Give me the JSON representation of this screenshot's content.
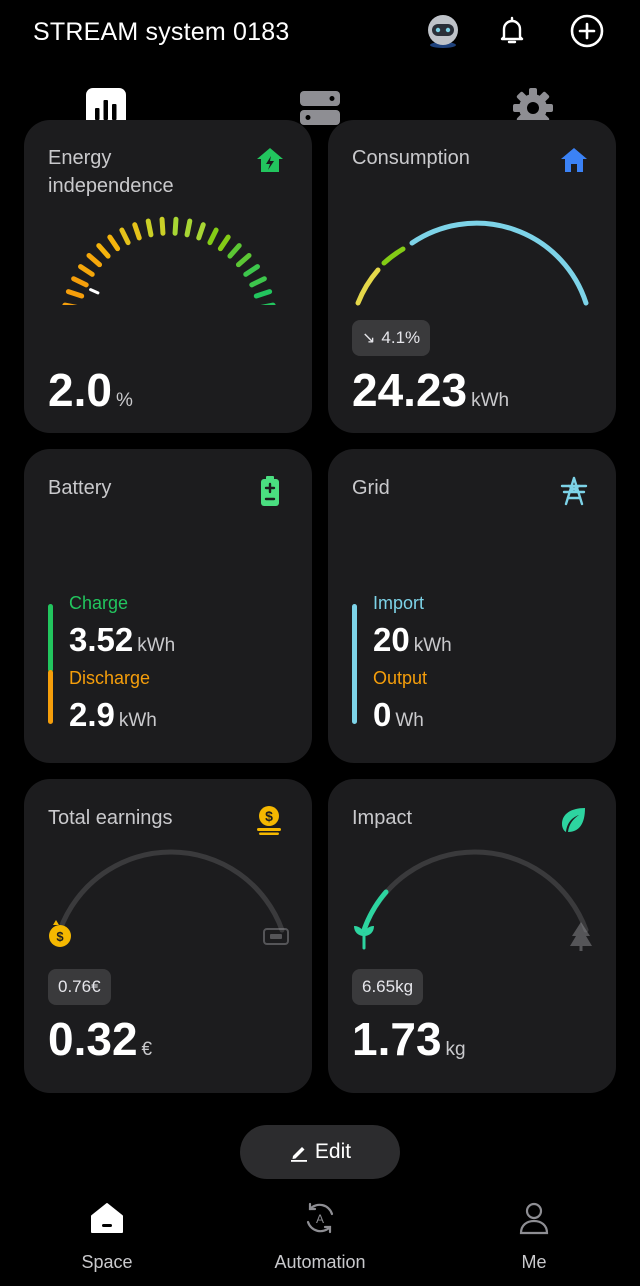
{
  "header": {
    "title": "STREAM system 0183",
    "icons": [
      "robot-avatar-icon",
      "bell-icon",
      "add-icon"
    ]
  },
  "topnav": {
    "tabs": [
      "stats-icon",
      "devices-icon",
      "settings-icon"
    ],
    "active_tab": "stats-icon"
  },
  "cards": {
    "energy_independence": {
      "title": "Energy\nindependence",
      "title_line1": "Energy",
      "title_line2": "independence",
      "value": "2.0",
      "unit": "%",
      "level_percent": 2.0,
      "icon": "house-bolt-icon",
      "accent": "#22c55e"
    },
    "consumption": {
      "title": "Consumption",
      "change": "4.1%",
      "change_direction": "down",
      "value": "24.23",
      "unit": "kWh",
      "icon": "house-icon",
      "accent": "#3b82f6"
    },
    "battery": {
      "title": "Battery",
      "charge_label": "Charge",
      "charge_value": "3.52",
      "charge_unit": "kWh",
      "discharge_label": "Discharge",
      "discharge_value": "2.9",
      "discharge_unit": "kWh",
      "icon": "battery-icon",
      "charge_color": "#22c55e",
      "discharge_color": "#f59e0b"
    },
    "grid": {
      "title": "Grid",
      "import_label": "Import",
      "import_value": "20",
      "import_unit": "kWh",
      "output_label": "Output",
      "output_value": "0",
      "output_unit": "Wh",
      "icon": "power-tower-icon",
      "import_color": "#7dd3e8",
      "output_color": "#f59e0b"
    },
    "total_earnings": {
      "title": "Total earnings",
      "pill": "0.76€",
      "value": "0.32",
      "unit": "€",
      "icon": "coin-stack-icon",
      "accent": "#f5b800"
    },
    "impact": {
      "title": "Impact",
      "pill": "6.65kg",
      "value": "1.73",
      "unit": "kg",
      "icon": "leaf-icon",
      "accent": "#2dd4a0"
    }
  },
  "edit_button": {
    "label": "Edit"
  },
  "bottomnav": {
    "items": [
      {
        "label": "Space",
        "icon": "home-icon",
        "active": true
      },
      {
        "label": "Automation",
        "icon": "automation-icon",
        "active": false
      },
      {
        "label": "Me",
        "icon": "person-icon",
        "active": false
      }
    ]
  }
}
